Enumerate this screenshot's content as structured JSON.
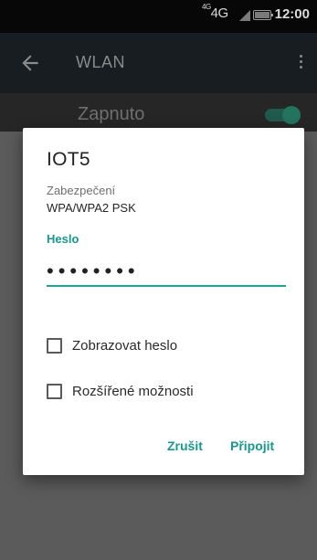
{
  "status_bar": {
    "network": "4G",
    "network_prefix": "4G",
    "battery_label": "100",
    "time": "12:00",
    "icons": [
      "network-4g-icon",
      "signal-icon",
      "battery-icon"
    ]
  },
  "app_bar": {
    "title": "WLAN",
    "icons": [
      "back-arrow-icon",
      "overflow-menu-icon"
    ]
  },
  "toggle_row": {
    "label": "Zapnuto",
    "state": "on"
  },
  "dialog": {
    "title": "IOT5",
    "security_label": "Zabezpečení",
    "security_value": "WPA/WPA2 PSK",
    "password_label": "Heslo",
    "password_value": "12345678",
    "checkboxes": [
      {
        "label": "Zobrazovat heslo",
        "checked": false
      },
      {
        "label": "Rozšířené možnosti",
        "checked": false
      }
    ],
    "cancel_label": "Zrušit",
    "connect_label": "Připojit"
  },
  "colors": {
    "accent": "#14998c",
    "status_bar_bg": "#070707",
    "app_bar_bg": "#171d20",
    "scrim_bg": "#5b5b5b",
    "dialog_bg": "#ffffff"
  }
}
